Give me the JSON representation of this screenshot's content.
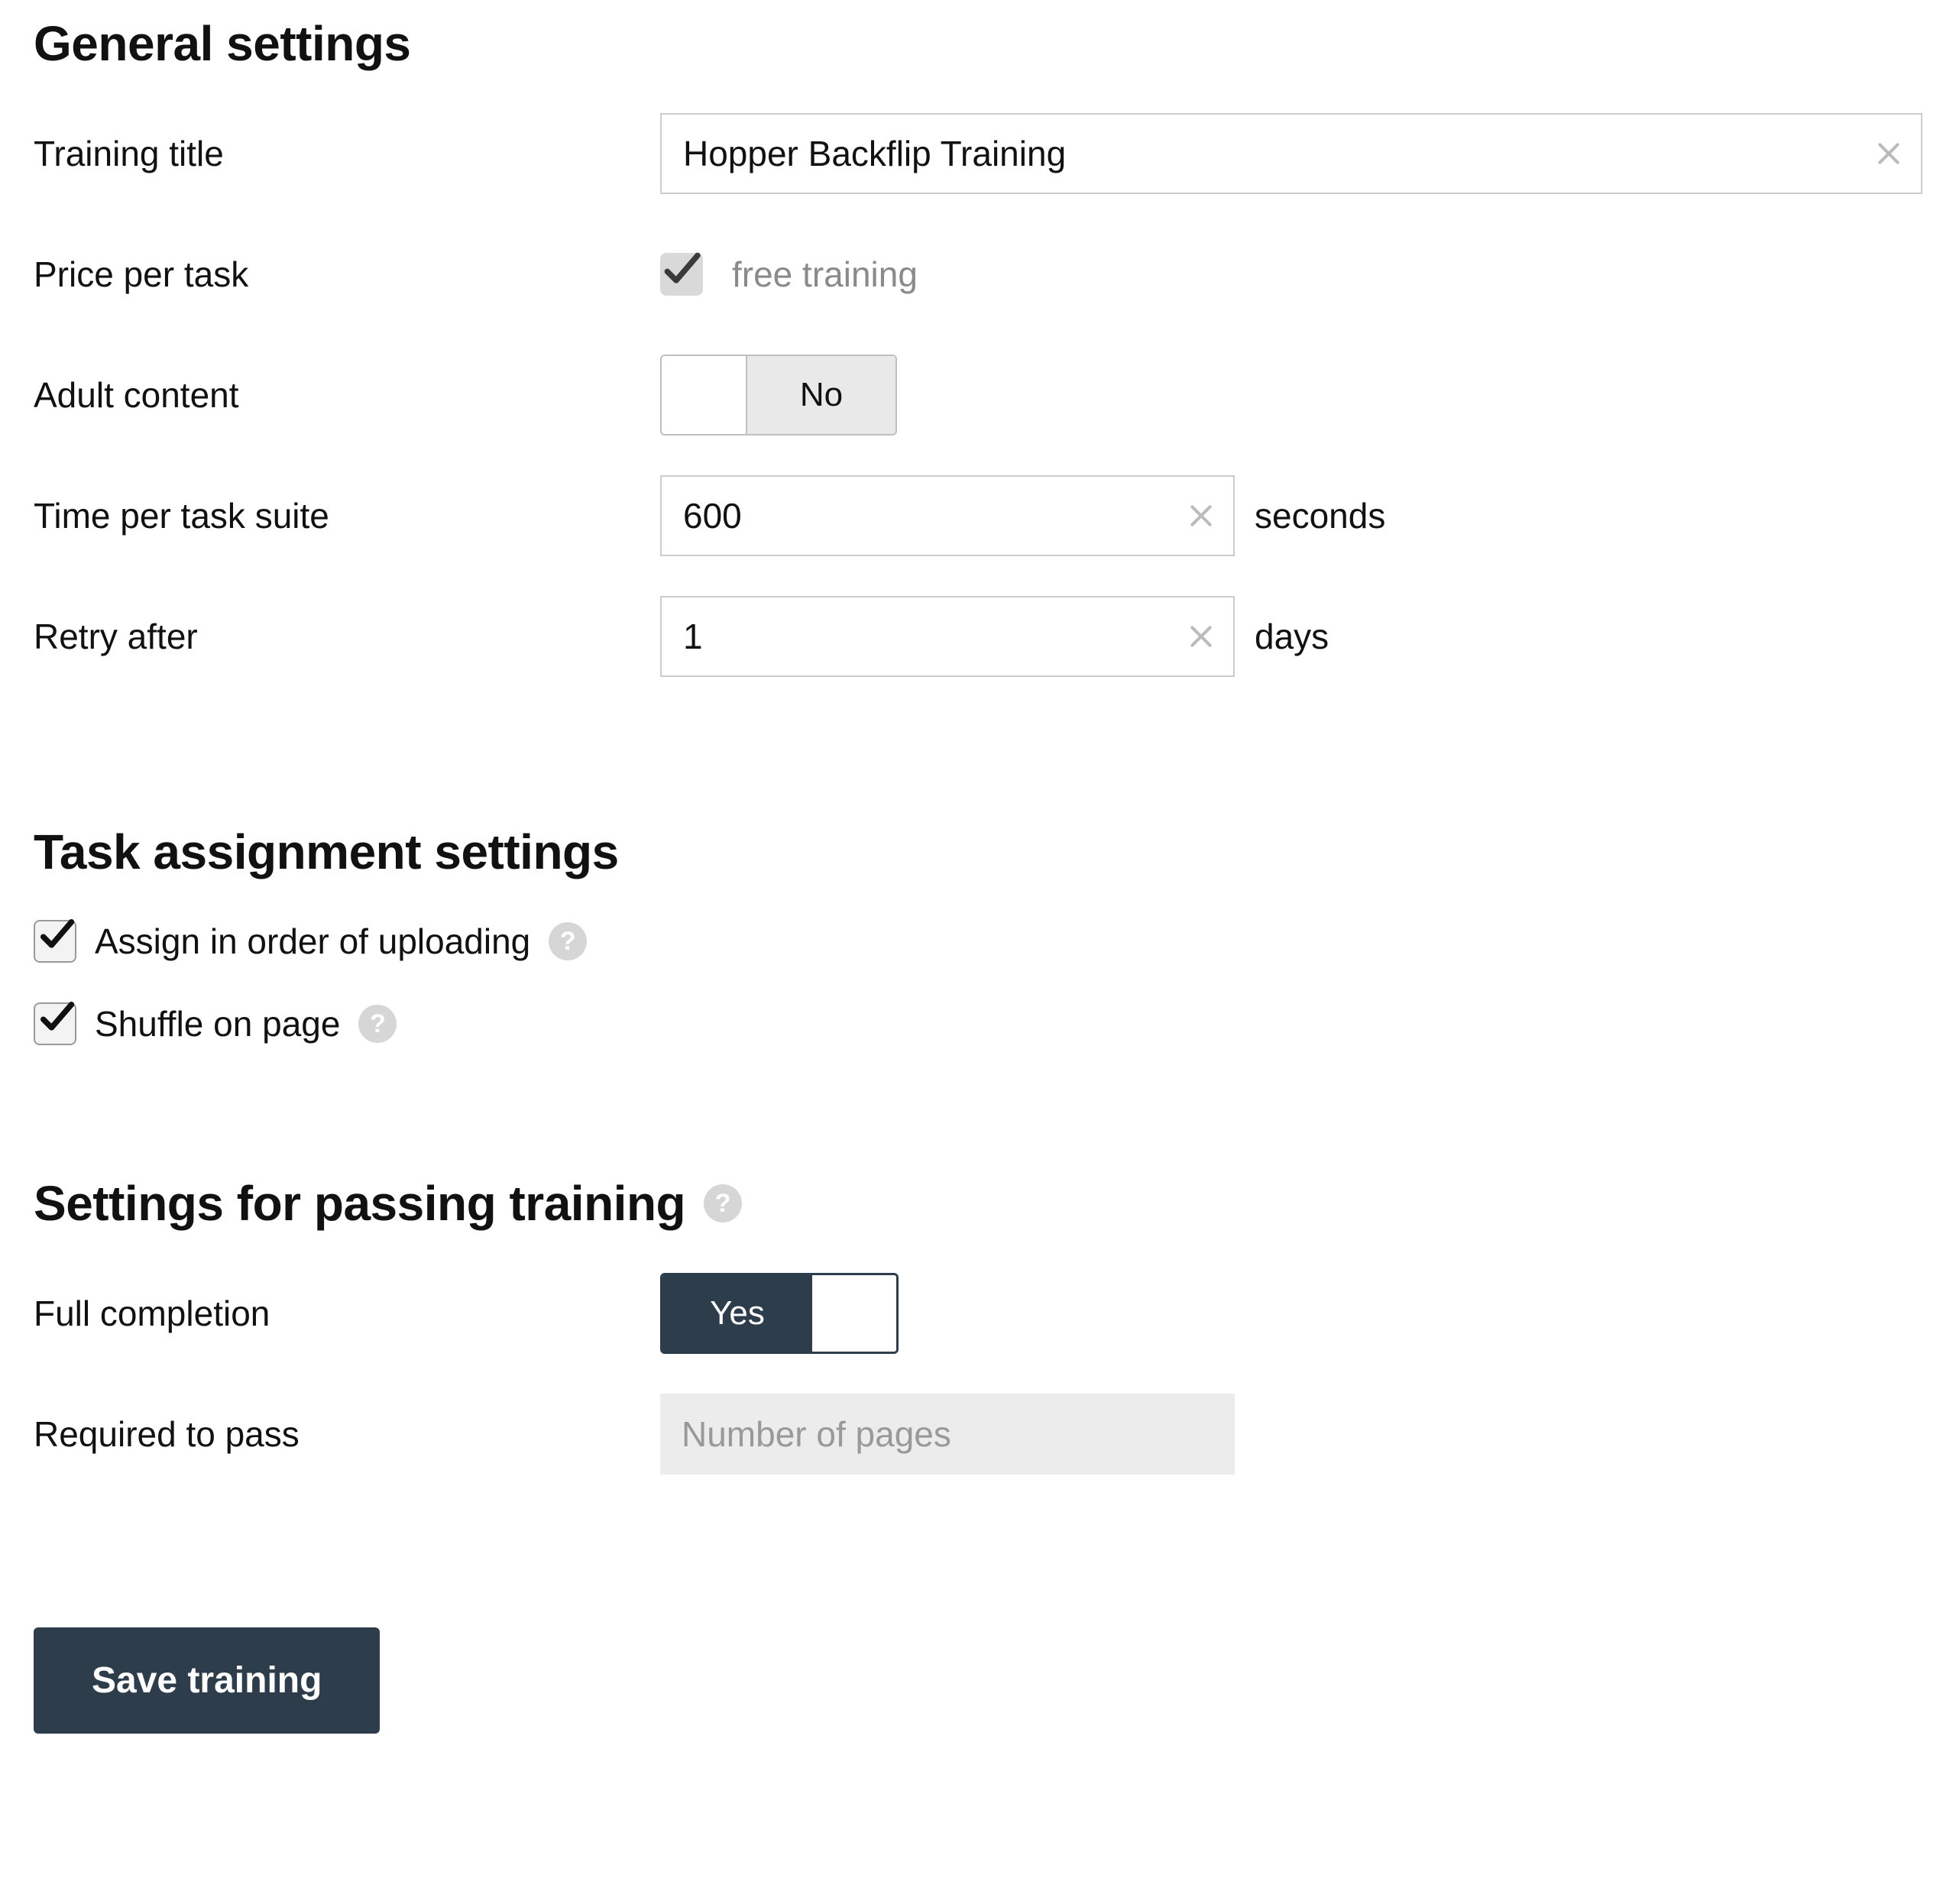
{
  "sections": {
    "general": "General settings",
    "task_assignment": "Task assignment settings",
    "passing": "Settings for passing training"
  },
  "general": {
    "training_title_label": "Training title",
    "training_title_value": "Hopper Backflip Training",
    "price_label": "Price per task",
    "price_note": "free training",
    "adult_label": "Adult content",
    "adult_value_off": "No",
    "time_label": "Time per task suite",
    "time_value": "600",
    "time_unit": "seconds",
    "retry_label": "Retry after",
    "retry_value": "1",
    "retry_unit": "days"
  },
  "task_assignment": {
    "assign_order_label": "Assign in order of uploading",
    "assign_order_checked": true,
    "shuffle_label": "Shuffle on page",
    "shuffle_checked": true
  },
  "passing": {
    "full_completion_label": "Full completion",
    "full_completion_value_on": "Yes",
    "required_label": "Required to pass",
    "required_placeholder": "Number of pages"
  },
  "actions": {
    "save": "Save training"
  },
  "help_glyph": "?"
}
